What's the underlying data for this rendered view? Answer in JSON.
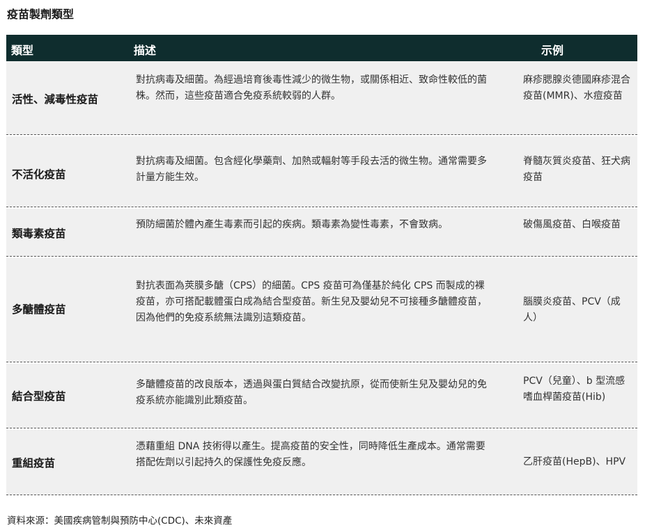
{
  "title": "疫苗製劑類型",
  "table": {
    "headers": {
      "type": "類型",
      "description": "描述",
      "example": "示例"
    },
    "rows": [
      {
        "type": "活性、減毒性疫苗",
        "description": "對抗病毒及細菌。為經過培育後毒性減少的微生物，或關係相近、致命性較低的菌株。然而，這些疫苗適合免疫系統較弱的人群。",
        "example": "麻疹腮腺炎德國麻疹混合疫苗(MMR)、水痘疫苗"
      },
      {
        "type": "不活化疫苗",
        "description": "對抗病毒及細菌。包含經化學藥劑、加熱或輻射等手段去活的微生物。通常需要多計量方能生效。",
        "example": "脊髓灰質炎疫苗、狂犬病疫苗"
      },
      {
        "type": "類毒素疫苗",
        "description": "預防細菌於體內產生毒素而引起的疾病。類毒素為變性毒素，不會致病。",
        "example": "破傷風疫苗、白喉疫苗"
      },
      {
        "type": "多醣體疫苗",
        "description": "對抗表面為莢膜多醣（CPS）的細菌。CPS 疫苗可為僅基於純化 CPS 而製成的裸疫苗，亦可搭配載體蛋白成為結合型疫苗。新生兒及嬰幼兒不可接種多醣體疫苗，因為他們的免疫系統無法識別這類疫苗。",
        "example": "腦膜炎疫苗、PCV（成人）"
      },
      {
        "type": "結合型疫苗",
        "description": "多醣體疫苗的改良版本，透過與蛋白質結合改變抗原，從而使新生兒及嬰幼兒的免疫系統亦能識別此類疫苗。",
        "example": "PCV（兒童）、b 型流感嗜血桿菌疫苗(Hib)"
      },
      {
        "type": "重組疫苗",
        "description": "憑藉重組 DNA 技術得以產生。提高疫苗的安全性，同時降低生產成本。通常需要搭配佐劑以引起持久的保護性免疫反應。",
        "example": "乙肝疫苗(HepB)、HPV"
      }
    ]
  },
  "source": "資料來源：美國疾病管制與預防中心(CDC)、未來資產"
}
